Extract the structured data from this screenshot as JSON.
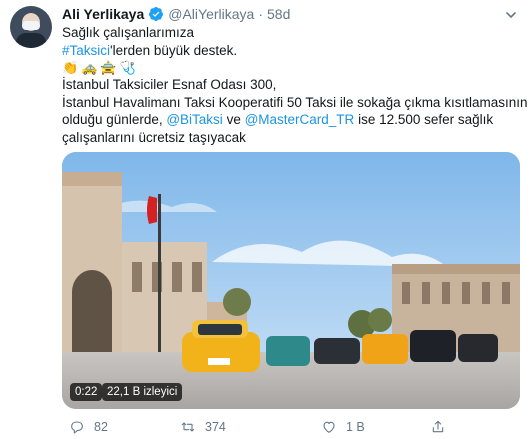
{
  "author": {
    "name": "Ali Yerlikaya",
    "handle": "@AliYerlikaya",
    "separator": "·",
    "time": "58d"
  },
  "tweet": {
    "line1": "Sağlık çalışanlarımıza",
    "hashtag": "#Taksici",
    "line2_suffix": "'lerden büyük destek.",
    "emojis": [
      "👏",
      "🚕",
      "🚖",
      "🩺"
    ],
    "line3": "İstanbul Taksiciler Esnaf Odası 300,",
    "line4": "İstanbul Havalimanı Taksi Kooperatifi 50 Taksi ile sokağa çıkma kısıtlamasının",
    "line5_prefix": "olduğu günlerde, ",
    "mention1": "@BiTaksi",
    "line5_mid": " ve ",
    "mention2": "@MasterCard_TR",
    "line5_suffix": " ise 12.500 sefer sağlık",
    "line6": "çalışanlarını ücretsiz taşıyacak"
  },
  "video": {
    "duration": "0:22",
    "views": "22,1 B izleyici"
  },
  "actions": {
    "replies": "82",
    "retweets": "374",
    "likes": "1 B"
  },
  "colors": {
    "link": "#1b95e0",
    "secondary": "#657786",
    "verified": "#1da1f2"
  }
}
